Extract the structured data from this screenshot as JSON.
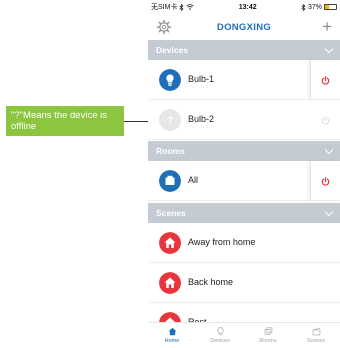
{
  "annotation": {
    "text": "\"?\"Means the device is offline"
  },
  "status_bar": {
    "carrier": "无SIM卡",
    "time": "13:42",
    "battery": "37%",
    "battery_level": 0.37
  },
  "nav": {
    "title": "DONGXING",
    "add_symbol": "+"
  },
  "sections": {
    "devices": {
      "label": "Devices"
    },
    "rooms": {
      "label": "Rooms"
    },
    "scenes": {
      "label": "Scenes"
    }
  },
  "devices": [
    {
      "label": "Bulb-1",
      "online": true,
      "icon": "bulb-icon",
      "power_icon": "power-icon"
    },
    {
      "label": "Bulb-2",
      "online": false,
      "icon": "offline-question-icon",
      "power_icon": "power-icon"
    }
  ],
  "rooms": [
    {
      "label": "All",
      "icon": "room-icon",
      "power_icon": "power-icon"
    }
  ],
  "scenes": [
    {
      "label": "Away from home",
      "icon": "scene-home-icon"
    },
    {
      "label": "Back home",
      "icon": "scene-home-icon"
    },
    {
      "label": "Rest",
      "icon": "scene-home-icon"
    }
  ],
  "tabs": [
    {
      "label": "Home",
      "icon": "home-icon",
      "active": true
    },
    {
      "label": "Devices",
      "icon": "bulb-icon",
      "active": false
    },
    {
      "label": "Rooms",
      "icon": "room-icon",
      "active": false
    },
    {
      "label": "Scenes",
      "icon": "scene-icon",
      "active": false
    }
  ],
  "colors": {
    "brand_blue": "#1f6fb8",
    "scene_red": "#e8343b",
    "power_red": "#e8343b",
    "section_gray": "#c4cbd3",
    "callout_green": "#8cc63f",
    "offline_gray": "#e6e6e6"
  }
}
